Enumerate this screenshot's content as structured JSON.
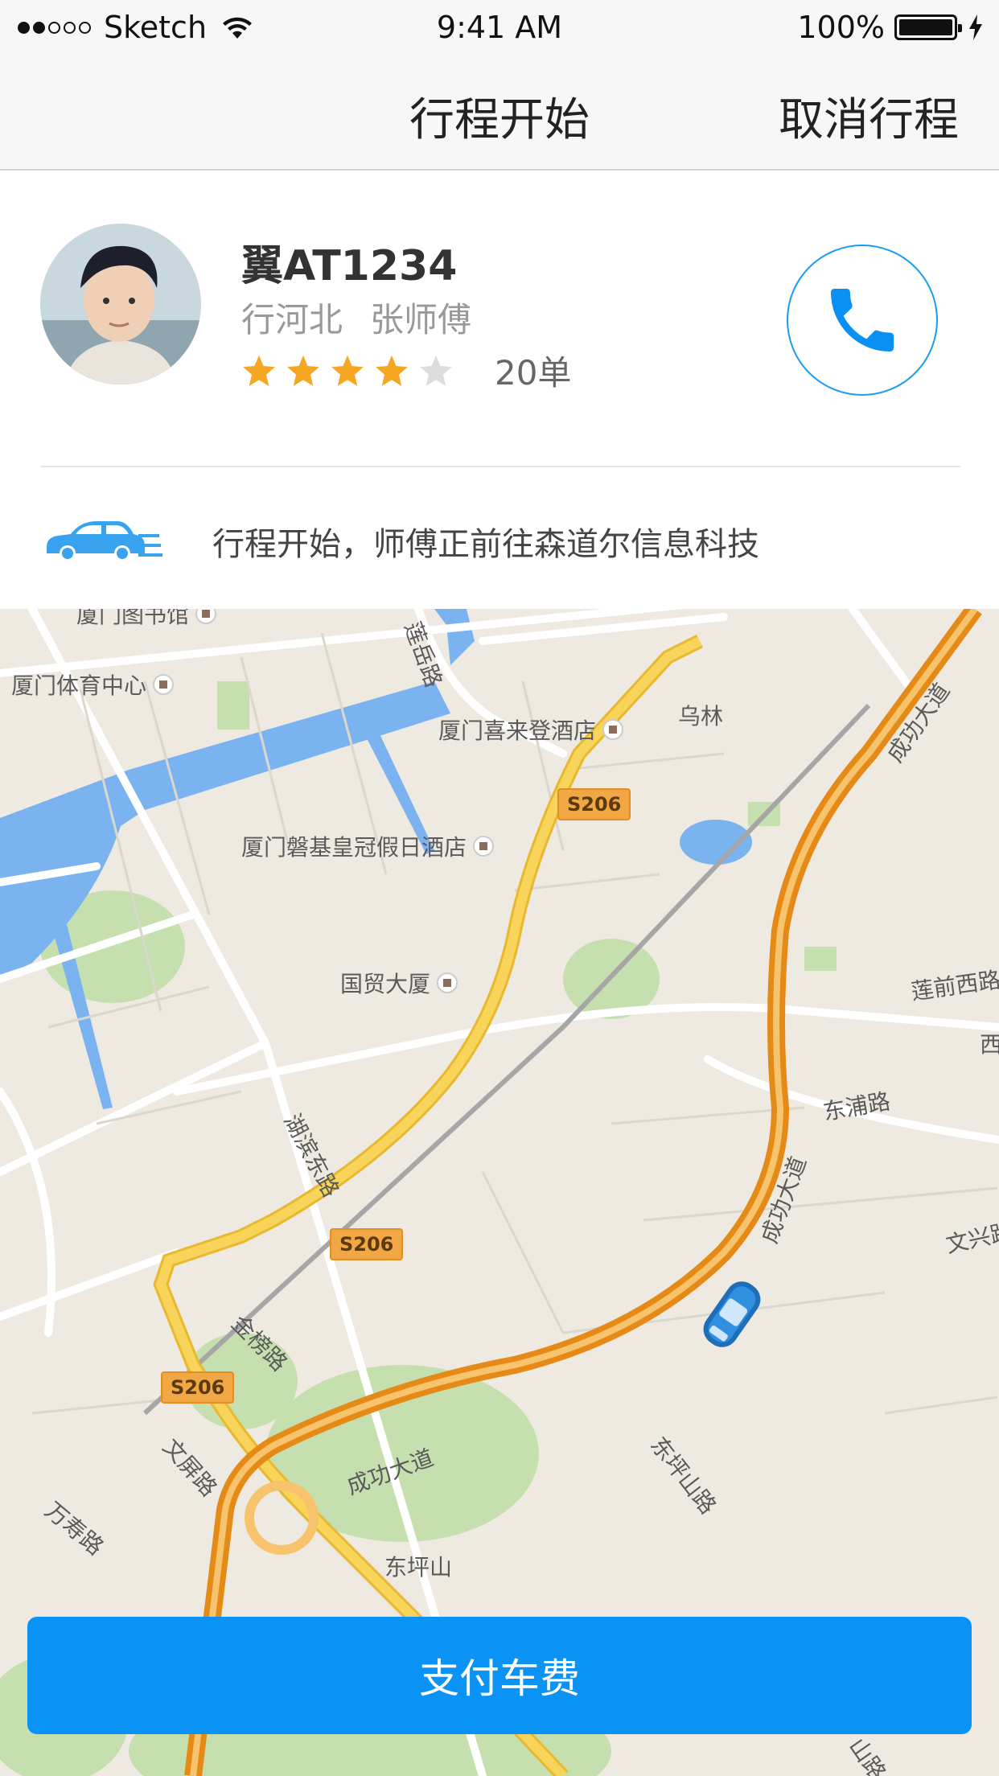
{
  "status_bar": {
    "carrier": "Sketch",
    "time": "9:41 AM",
    "battery": "100%"
  },
  "nav": {
    "title": "行程开始",
    "cancel_label": "取消行程"
  },
  "driver": {
    "plate": "翼AT1234",
    "company": "行河北",
    "name": "张师傅",
    "rating_stars": 4,
    "rating_max": 5,
    "orders": "20单"
  },
  "trip": {
    "status_text": "行程开始，师傅正前往森道尔信息科技"
  },
  "map": {
    "labels": {
      "library": "厦门图书馆",
      "stadium": "厦门体育中心",
      "lianban_road": "莲岳路",
      "hilton": "厦门喜来登酒店",
      "wulin": "乌林",
      "chenggong_top": "成功大道",
      "holiday_inn": "厦门磐基皇冠假日酒店",
      "guomao": "国贸大厦",
      "lianqian_west": "莲前西路",
      "xi": "西",
      "dongdu": "东浦路",
      "hubin_east": "湖滨东路",
      "chenggong_mid": "成功大道",
      "wenxing": "文兴路",
      "jinbang": "金榜路",
      "wenping": "文屏路",
      "wanshou": "万寿路",
      "chenggong_bottom": "成功大道",
      "dongping_road": "东坪山路",
      "dongpingshan": "东坪山",
      "shan": "山路"
    },
    "shields": {
      "s206_a": "S206",
      "s206_b": "S206",
      "s206_c": "S206"
    }
  },
  "pay_button": {
    "label": "支付车费"
  },
  "colors": {
    "accent": "#0a93f5",
    "star": "#f5a623",
    "star_empty": "#dddddd",
    "road_major": "#f6c344",
    "water": "#7ab3ef"
  }
}
